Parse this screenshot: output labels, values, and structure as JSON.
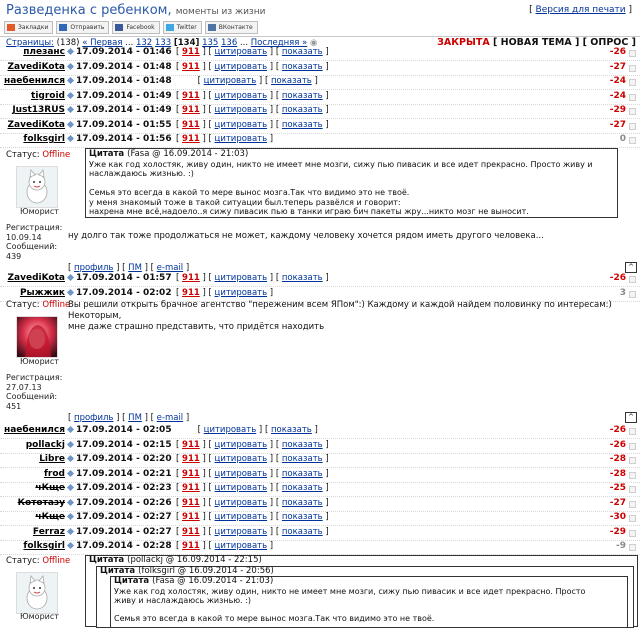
{
  "header": {
    "title": "Разведенка с ребенком,",
    "subtitle": "моменты из жизни",
    "print_link": "Версия для печати"
  },
  "share": [
    "Закладки",
    "Отправить",
    "Facebook",
    "Twitter",
    "ВКонтакте"
  ],
  "pager": {
    "pages_label": "Страницы:",
    "count": "(138)",
    "first": "« Первая",
    "dots": "...",
    "p132": "132",
    "p133": "133",
    "current": "[134]",
    "p135": "135",
    "p136": "136",
    "last": "Последняя »"
  },
  "topic_status": {
    "closed": "ЗАКРЫТА",
    "new_topic": "НОВАЯ ТЕМА",
    "poll": "ОПРОС"
  },
  "labels": {
    "n911": "911",
    "quote": "цитировать",
    "show": "показать",
    "status": "Статус:",
    "offline": "Offline",
    "rank": "Юморист",
    "reg": "Регистрация:",
    "msgs": "Сообщений:",
    "profile": "профиль",
    "pm": "ПМ",
    "email": "e-mail",
    "cite": "Цитата"
  },
  "rows_a": [
    {
      "nick": "плезанс",
      "date": "17.09.2014 - 01:46",
      "has911": true,
      "score": "-26",
      "strike": false
    },
    {
      "nick": "ZavediKota",
      "date": "17.09.2014 - 01:48",
      "has911": true,
      "score": "-27",
      "strike": false
    },
    {
      "nick": "наебенился",
      "date": "17.09.2014 - 01:48",
      "has911": false,
      "score": "-24",
      "strike": false
    },
    {
      "nick": "tigroid",
      "date": "17.09.2014 - 01:49",
      "has911": true,
      "score": "-24",
      "strike": false
    },
    {
      "nick": "Just13RUS",
      "date": "17.09.2014 - 01:49",
      "has911": true,
      "score": "-29",
      "strike": false
    },
    {
      "nick": "ZavediKota",
      "date": "17.09.2014 - 01:55",
      "has911": true,
      "score": "-27",
      "strike": false
    },
    {
      "nick": "folksgirl",
      "date": "17.09.2014 - 01:56",
      "has911": true,
      "score": "0",
      "strike": false,
      "grey": true,
      "nopokaz": true
    }
  ],
  "post1": {
    "quote_meta": "(Fasa @ 16.09.2014 - 21:03)",
    "quote_lines": [
      "Уже как год холостяк, живу один, никто не имеет мне мозги, сижу пью пивасик и все идет прекрасно. Просто живу и",
      "наслаждаюсь жизнью. :)",
      "",
      "Семья это всегда в какой то мере вынос мозга.Так что видимо это не твоё.",
      "у меня знакомый тоже в такой ситуации был.теперь развёлся и говорит:",
      "нахрена мне всё,надоело..я сижу пивасик пью в танки играю бич пакеты жру...никто мозг не выносит."
    ],
    "text": "ну долго так тоже продолжаться не может, каждому человеку хочется рядом иметь другого человека...",
    "reg_date": "10.09.14",
    "msg_count": "439"
  },
  "rows_b": [
    {
      "nick": "ZavediKota",
      "date": "17.09.2014 - 01:57",
      "has911": true,
      "score": "-26",
      "strike": false
    },
    {
      "nick": "Рыжжик",
      "date": "17.09.2014 - 02:02",
      "has911": true,
      "score": "3",
      "strike": false,
      "grey": true,
      "nopokaz": true
    }
  ],
  "post2": {
    "text1": "Вы решили открыть брачное агентство \"переженим всем ЯПом\":) Каждому и каждой найдем половинку по интересам:) Некоторым,",
    "text2": "мне даже страшно представить, что придётся находить",
    "reg_date": "27.07.13",
    "msg_count": "451"
  },
  "rows_c": [
    {
      "nick": "наебенился",
      "date": "17.09.2014 - 02:05",
      "has911": false,
      "score": "-26",
      "strike": false
    },
    {
      "nick": "pollackj",
      "date": "17.09.2014 - 02:15",
      "has911": true,
      "score": "-26",
      "strike": false
    },
    {
      "nick": "Libre",
      "date": "17.09.2014 - 02:20",
      "has911": true,
      "score": "-28",
      "strike": false
    },
    {
      "nick": "frod",
      "date": "17.09.2014 - 02:21",
      "has911": true,
      "score": "-28",
      "strike": false
    },
    {
      "nick": "чКще",
      "date": "17.09.2014 - 02:23",
      "has911": true,
      "score": "-25",
      "strike": true
    },
    {
      "nick": "Кототазу",
      "date": "17.09.2014 - 02:26",
      "has911": true,
      "score": "-27",
      "strike": true
    },
    {
      "nick": "чКще",
      "date": "17.09.2014 - 02:27",
      "has911": true,
      "score": "-30",
      "strike": true
    },
    {
      "nick": "Ferraz",
      "date": "17.09.2014 - 02:27",
      "has911": true,
      "score": "-29",
      "strike": false
    },
    {
      "nick": "folksgirl",
      "date": "17.09.2014 - 02:28",
      "has911": true,
      "score": "-9",
      "strike": false,
      "grey": true,
      "nopokaz": true
    }
  ],
  "post3": {
    "q1_meta": "(pollackj @ 16.09.2014 - 22:15)",
    "q2_meta": "(folksgirl @ 16.09.2014 - 20:56)",
    "q3_meta": "(Fasa @ 16.09.2014 - 21:03)",
    "q3_line1": "Уже как год холостяк, живу один, никто не имеет мне мозги, сижу пью пивасик и все идет прекрасно. Просто",
    "q3_line2": "живу и наслаждаюсь жизнью. :)",
    "q3_line3": "Семья это всегда в какой то мере вынос мозга.Так что видимо это не твоё."
  },
  "colors": {
    "accent": "#2a5aa8",
    "red": "#cc0000",
    "link": "#003399"
  }
}
